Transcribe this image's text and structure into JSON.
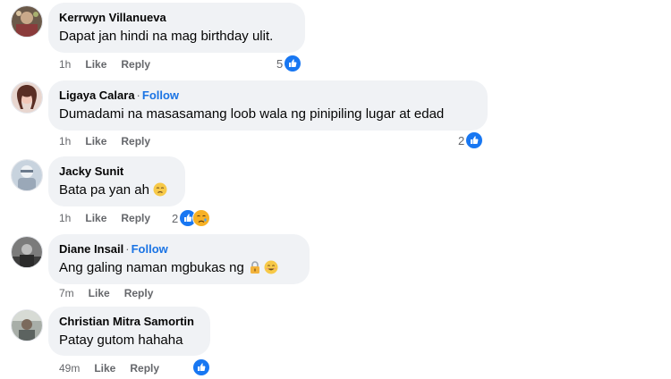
{
  "comments": [
    {
      "name": "Kerrwyn Villanueva",
      "follow": "",
      "text": "Dapat jan hindi na mag birthday ulit.",
      "time": "1h",
      "like": "Like",
      "reply": "Reply",
      "reaction_count": "5",
      "reactions": [
        "like-reaction-icon"
      ]
    },
    {
      "name": "Ligaya Calara",
      "follow": "Follow",
      "text": "Dumadami na masasamang loob wala ng pinipiling lugar at edad",
      "time": "1h",
      "like": "Like",
      "reply": "Reply",
      "reaction_count": "2",
      "reactions": [
        "like-reaction-icon"
      ]
    },
    {
      "name": "Jacky Sunit",
      "follow": "",
      "text": "Bata pa yan ah",
      "text_emoji": "disappointed-face-emoji",
      "time": "1h",
      "like": "Like",
      "reply": "Reply",
      "reaction_count": "2",
      "reactions": [
        "like-reaction-icon",
        "sad-reaction-icon"
      ]
    },
    {
      "name": "Diane Insail",
      "follow": "Follow",
      "text": "Ang galing naman mgbukas ng",
      "text_emoji": "lock-and-smile-emoji",
      "time": "7m",
      "like": "Like",
      "reply": "Reply",
      "reaction_count": "",
      "reactions": []
    },
    {
      "name": "Christian Mitra Samortin",
      "follow": "",
      "text": "Patay gutom hahaha",
      "time": "49m",
      "like": "Like",
      "reply": "Reply",
      "reaction_count": "",
      "reactions": [
        "like-reaction-icon"
      ]
    }
  ],
  "separator": "·",
  "colors": {
    "bubble": "#f0f2f5",
    "link_blue": "#1b74e4",
    "meta_gray": "#65676b",
    "like_blue": "#1877f2",
    "sad_yellow": "#f7b125"
  }
}
